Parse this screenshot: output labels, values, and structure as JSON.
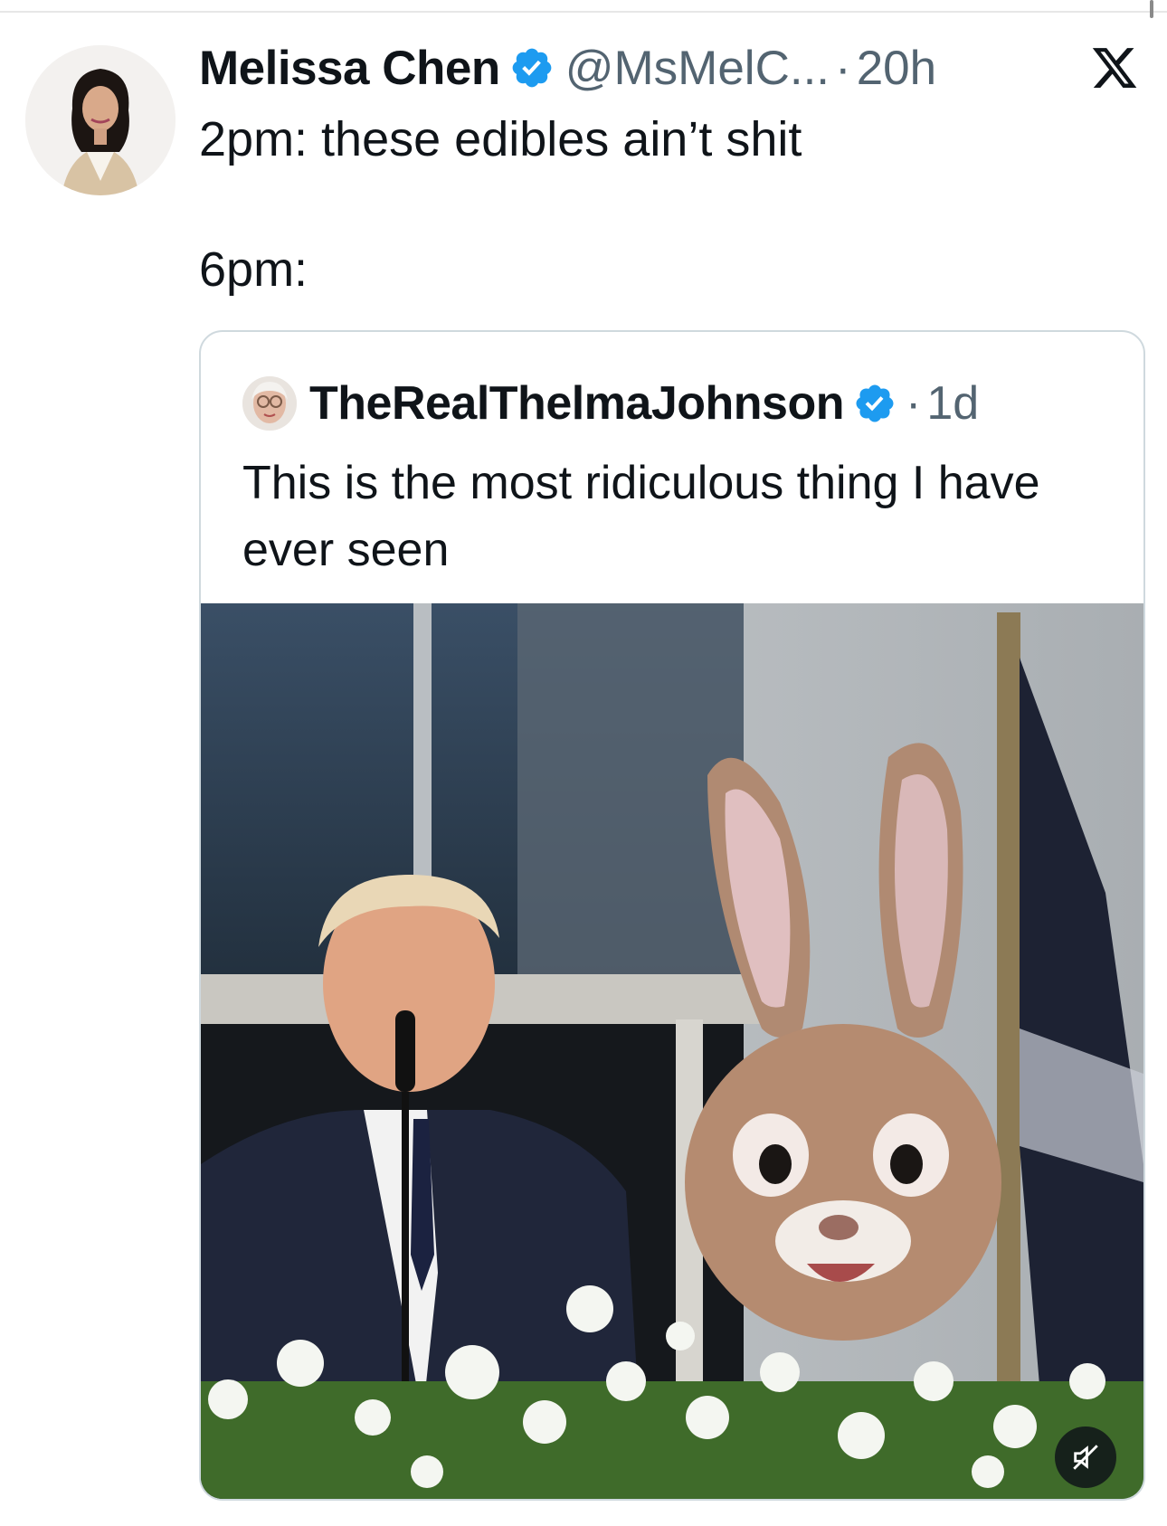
{
  "tweet": {
    "author_name": "Melissa Chen",
    "handle": "@MsMelC...",
    "separator": "·",
    "time": "20h",
    "text": "2pm: these edibles ain’t shit\n\n6pm:",
    "verified": true,
    "avatar_icon": "woman-portrait-avatar",
    "platform_icon": "x-logo-icon"
  },
  "quoted_tweet": {
    "author_name": "TheRealThelmaJohnson",
    "separator": "·",
    "time": "1d",
    "text": "This is the most ridiculous thing I have ever seen",
    "verified": true,
    "avatar_icon": "elderly-woman-avatar",
    "media": {
      "type": "video",
      "description_icon": "video-thumbnail",
      "mute_icon": "muted-speaker-icon"
    }
  },
  "colors": {
    "text": "#0f1419",
    "secondary": "#536471",
    "verified_blue": "#1d9bf0",
    "border": "#cfd9de"
  }
}
